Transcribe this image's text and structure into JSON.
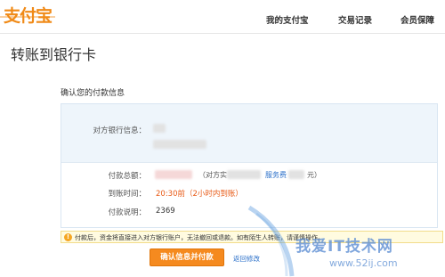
{
  "header": {
    "logo_text": "支付宝",
    "nav": [
      "我的支付宝",
      "交易记录",
      "会员保障"
    ]
  },
  "page_title": "转账到银行卡",
  "section_label": "确认您的付款信息",
  "details": {
    "bank_info_label": "对方银行信息：",
    "amount_label": "付款总额：",
    "amount_note": "（对方实",
    "service_fee_link": "服务费",
    "service_fee_tail": "元）",
    "arrival_label": "到账时间：",
    "arrival_value": "20:30前（2小时内到账）",
    "remark_label": "付款说明：",
    "remark_value": "2369"
  },
  "notice": {
    "icon": "!",
    "text": "付款后，资金将直接进入对方银行账户，无法撤回或退款。如有陌生人转账，请谨慎操作。"
  },
  "actions": {
    "confirm_label": "确认信息并付款",
    "back_label": "返回修改"
  },
  "watermark": {
    "text": "我爱IT技术网",
    "url": "www.52ij.com"
  },
  "colors": {
    "brand_orange": "#f08a17",
    "button_orange": "#f58a1f",
    "link_blue": "#2a6fc9",
    "arrival_orange": "#e85b17"
  }
}
